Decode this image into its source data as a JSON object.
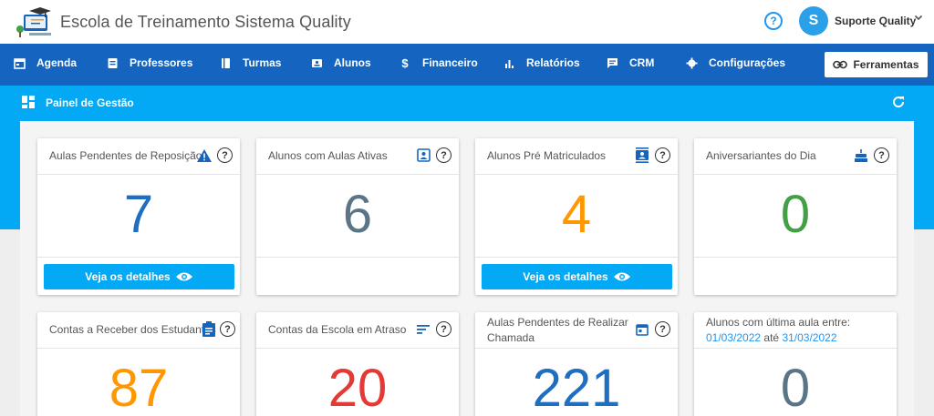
{
  "header": {
    "title": "Escola de Treinamento Sistema Quality",
    "help_label": "?",
    "user": {
      "initial": "S",
      "name": "Suporte Quality"
    }
  },
  "nav": {
    "items": [
      {
        "label": "Agenda",
        "icon": "calendar-icon"
      },
      {
        "label": "Professores",
        "icon": "briefcase-icon"
      },
      {
        "label": "Turmas",
        "icon": "book-icon"
      },
      {
        "label": "Alunos",
        "icon": "id-card-icon"
      },
      {
        "label": "Financeiro",
        "icon": "dollar-icon"
      },
      {
        "label": "Relatórios",
        "icon": "bar-chart-icon"
      },
      {
        "label": "CRM",
        "icon": "chat-icon"
      },
      {
        "label": "Configurações",
        "icon": "gear-icon"
      }
    ],
    "tools_label": "Ferramentas"
  },
  "panel": {
    "title": "Painel de Gestão"
  },
  "cards": [
    {
      "title": "Aulas Pendentes de Reposição",
      "value": "7",
      "color": "#1e6fc2",
      "details": "Veja os detalhes"
    },
    {
      "title": "Alunos com Aulas Ativas",
      "value": "6",
      "color": "#5a7585"
    },
    {
      "title": "Alunos Pré Matriculados",
      "value": "4",
      "color": "#ff9800",
      "details": "Veja os detalhes"
    },
    {
      "title": "Aniversariantes do Dia",
      "value": "0",
      "color": "#43a047"
    },
    {
      "title": "Contas a Receber dos Estudantes",
      "value": "87",
      "color": "#ff9800"
    },
    {
      "title": "Contas da Escola em Atraso",
      "value": "20",
      "color": "#e53935"
    },
    {
      "title_line1": "Aulas Pendentes de Realizar",
      "title_line2": "Chamada",
      "value": "221",
      "color": "#1e6fc2"
    },
    {
      "title_line1": "Alunos com última aula entre:",
      "date_from": "01/03/2022",
      "date_sep": "até",
      "date_to": "31/03/2022",
      "value": "0",
      "color": "#5a7585"
    }
  ],
  "colors": {
    "header_nav": "#1565c0",
    "banner": "#03a9f4",
    "accent": "#2196f3"
  }
}
